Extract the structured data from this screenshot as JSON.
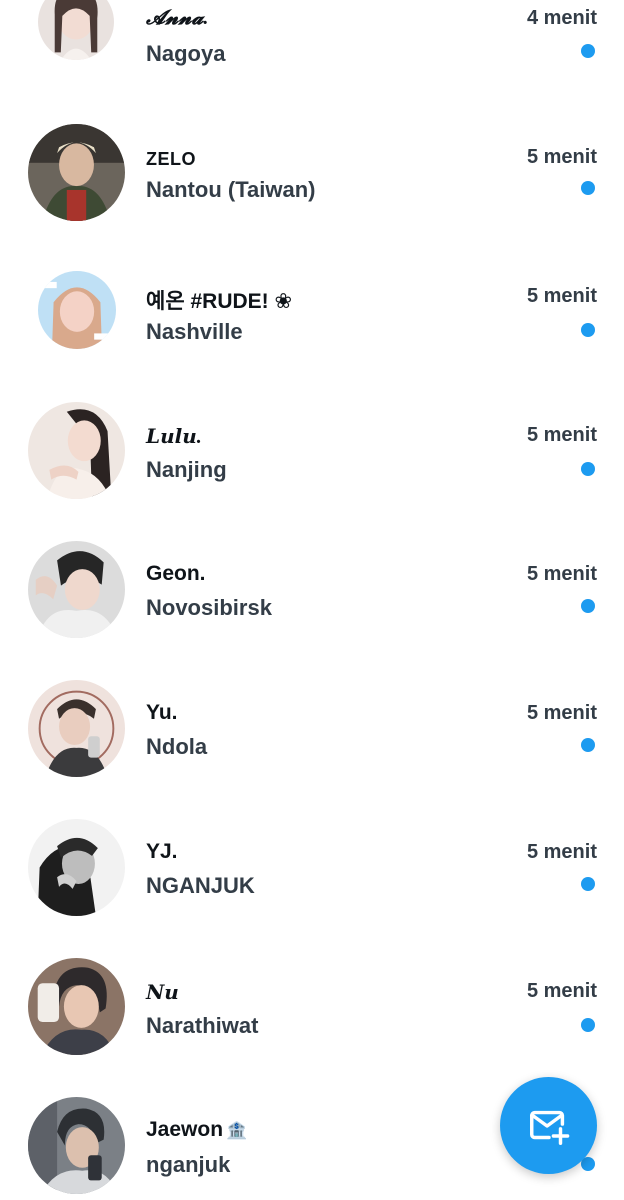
{
  "conversations": [
    {
      "name": "𝓐𝓷𝓷𝓪.",
      "message": "Nagoya",
      "time": "4 menit",
      "avatar_colors": [
        "#e9e2df",
        "#4a3a36"
      ]
    },
    {
      "name": "ZELO",
      "message": "Nantou (Taiwan)",
      "time": "5 menit",
      "avatar_colors": [
        "#6b655c",
        "#2f2d2a"
      ]
    },
    {
      "name": "예온 #RUDE! ❀",
      "message": "Nashville",
      "time": "5 menit",
      "avatar_colors": [
        "#bfe0f5",
        "#f4d2c6"
      ]
    },
    {
      "name": "𝑳𝒖𝒍𝒖.",
      "message": "Nanjing",
      "time": "5 menit",
      "avatar_colors": [
        "#efe7e2",
        "#2b2322"
      ]
    },
    {
      "name": "Geon.",
      "message": "Novosibirsk",
      "time": "5 menit",
      "avatar_colors": [
        "#dcdcdc",
        "#262626"
      ]
    },
    {
      "name": "Yu.",
      "message": "Ndola",
      "time": "5 menit",
      "avatar_colors": [
        "#efe2dd",
        "#3a302c"
      ]
    },
    {
      "name": "YJ.",
      "message": "NGANJUK",
      "time": "5 menit",
      "avatar_colors": [
        "#f2f2f2",
        "#1e1e1e"
      ]
    },
    {
      "name": "𝑵𝒖",
      "message": "Narathiwat",
      "time": "5 menit",
      "avatar_colors": [
        "#8b7466",
        "#2e2a2c"
      ]
    },
    {
      "name": "Jaewon",
      "badge": "🏦",
      "message": "nganjuk",
      "time": "",
      "avatar_colors": [
        "#7b8086",
        "#2d3034"
      ]
    }
  ],
  "compose_button": {
    "icon": "new-message-icon"
  },
  "colors": {
    "accent": "#1d9bf0",
    "name_text": "#0f1419",
    "secondary_text": "#333d47"
  }
}
